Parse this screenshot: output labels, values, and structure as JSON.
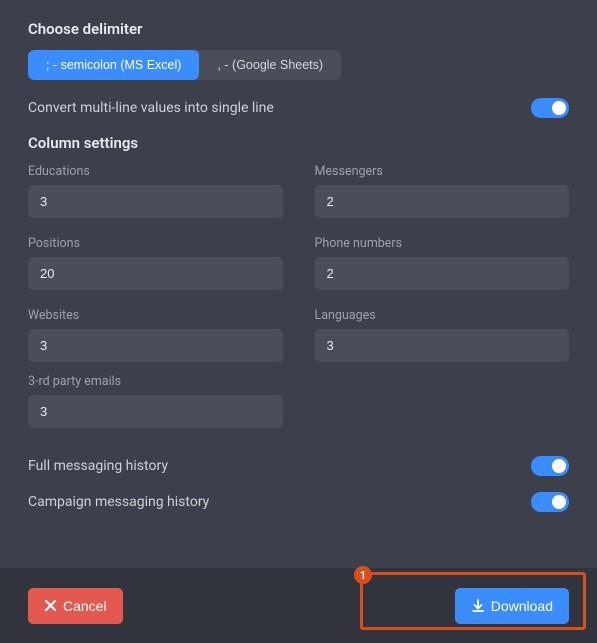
{
  "delimiter": {
    "title": "Choose delimiter",
    "options": [
      {
        "label": "; - semicolon (MS Excel)",
        "active": true
      },
      {
        "label": ", - (Google Sheets)",
        "active": false
      }
    ]
  },
  "convert_multiline": {
    "label": "Convert multi-line values into single line",
    "value": true
  },
  "column_settings": {
    "title": "Column settings",
    "fields": [
      {
        "label": "Educations",
        "value": "3"
      },
      {
        "label": "Messengers",
        "value": "2"
      },
      {
        "label": "Positions",
        "value": "20"
      },
      {
        "label": "Phone numbers",
        "value": "2"
      },
      {
        "label": "Websites",
        "value": "3"
      },
      {
        "label": "Languages",
        "value": "3"
      },
      {
        "label": "3-rd party emails",
        "value": "3"
      }
    ]
  },
  "toggles": [
    {
      "label": "Full messaging history",
      "value": true
    },
    {
      "label": "Campaign messaging history",
      "value": true
    }
  ],
  "footer": {
    "cancel": "Cancel",
    "download": "Download"
  },
  "highlight": {
    "badge": "1"
  }
}
